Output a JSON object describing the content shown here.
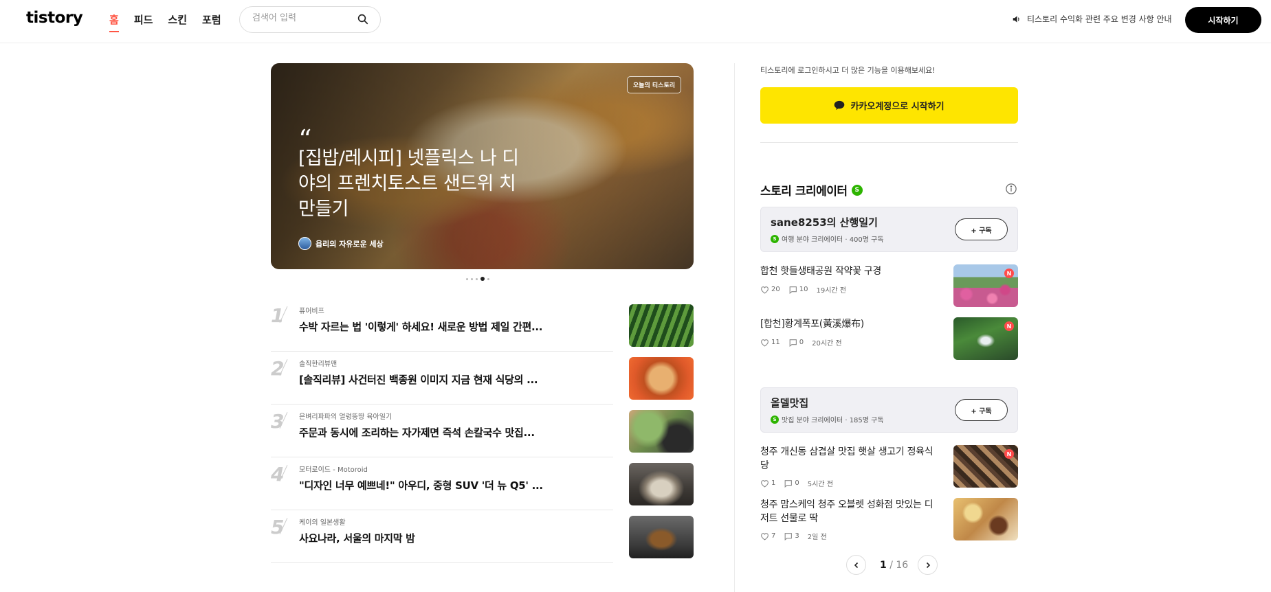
{
  "header": {
    "logo": "tistory",
    "nav": [
      {
        "label": "홈",
        "active": true
      },
      {
        "label": "피드",
        "active": false
      },
      {
        "label": "스킨",
        "active": false
      },
      {
        "label": "포럼",
        "active": false
      }
    ],
    "search_placeholder": "검색어 입력",
    "notice": "티스토리 수익화 관련 주요 변경 사항 안내",
    "start_label": "시작하기"
  },
  "hero": {
    "badge": "오늘의 티스토리",
    "quote_mark": "“",
    "title": "[집밥/레시피] 넷플릭스 나 디야의 프렌치토스트 샌드위 치 만들기",
    "author": "욥리의 자유로운 세상",
    "slides": 5,
    "active_slide": 4
  },
  "ranking": [
    {
      "rank": "1",
      "blog": "퓨어비프",
      "title": "수박 자르는 법 '이렇게' 하세요! 새로운 방법 제일 간편...",
      "thumb": "watermelon"
    },
    {
      "rank": "2",
      "blog": "솔직한리뷰맨",
      "title": "[솔직리뷰] 사건터진 백종원 이미지 지금 현재 식당의 ...",
      "thumb": "food-dish"
    },
    {
      "rank": "3",
      "blog": "은벼리파파의 얼렁뚱땅 육아일기",
      "title": "주문과 동시에 조리하는 자가제면 즉석 손칼국수 맛집...",
      "thumb": "noodles"
    },
    {
      "rank": "4",
      "blog": "모터로이드 - Motoroid",
      "title": "\"디자인 너무 예쁘네!\" 아우디, 중형 SUV '더 뉴 Q5' ...",
      "thumb": "car"
    },
    {
      "rank": "5",
      "blog": "케이의 일본생활",
      "title": "사요나라, 서울의 마지막 밤",
      "thumb": "person"
    }
  ],
  "sidebar": {
    "login_hint": "티스토리에 로그인하시고 더 많은 기능을 이용해보세요!",
    "kakao_label": "카카오계정으로 시작하기",
    "section_title": "스토리 크리에이터",
    "s_badge": "S",
    "creators": [
      {
        "name": "sane8253의 산행일기",
        "meta": "여행 분야 크리에이터 · 400명 구독",
        "subscribe": "+ 구독",
        "posts": [
          {
            "title": "합천 핫들생태공원 작약꽃 구경",
            "likes": "20",
            "comments": "10",
            "time": "19시간 전",
            "new": "N",
            "thumb": "flowers"
          },
          {
            "title": "[합천]황계폭포(黃溪爆布)",
            "likes": "11",
            "comments": "0",
            "time": "20시간 전",
            "new": "N",
            "thumb": "waterfall"
          }
        ]
      },
      {
        "name": "올델맛집",
        "meta": "맛집 분야 크리에이터 · 185명 구독",
        "subscribe": "+ 구독",
        "posts": [
          {
            "title": "청주 개신동 삼겹살 맛집 햇살 생고기 정육식당",
            "likes": "1",
            "comments": "0",
            "time": "5시간 전",
            "new": "N",
            "thumb": "bbq"
          },
          {
            "title": "청주 맘스케익 청주 오블렛 성화점 맛있는 디저트 선물로 딱",
            "likes": "7",
            "comments": "3",
            "time": "2일 전",
            "new": "",
            "thumb": "dessert"
          }
        ]
      }
    ],
    "pager": {
      "current": "1",
      "separator": " / ",
      "total": "16"
    }
  },
  "colors": {
    "accent": "#ff5544",
    "kakao": "#fee500",
    "creator_green": "#2db400",
    "new_red": "#ff4b4b"
  }
}
